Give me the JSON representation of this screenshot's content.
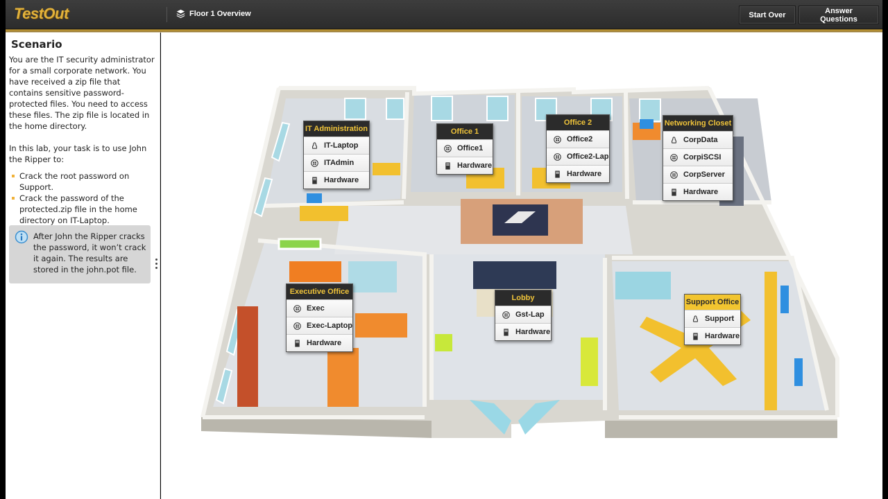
{
  "header": {
    "logo": "TestOut",
    "floor_label": "Floor 1 Overview",
    "floor_icon": "layers-icon",
    "buttons": {
      "start_over": "Start Over",
      "answer_questions": "Answer Questions"
    },
    "accent_color": "#e2b23b"
  },
  "sidebar": {
    "title": "Scenario",
    "intro": "You are the IT security administrator for a small corporate network. You have received a zip file that contains sensitive password-protected files. You need to access these files. The zip file is located in the home directory.",
    "task_lead": "In this lab, your task is to use John the Ripper to:",
    "tasks": [
      "Crack the root password on Support.",
      "Crack the password of the protected.zip file in the home directory on IT-Laptop."
    ],
    "note": "After John the Ripper cracks the password, it won’t crack it again. The results are stored in the john.pot file.",
    "note_icon": "info-icon"
  },
  "rooms": {
    "it_admin": {
      "title": "IT Administration",
      "items": [
        {
          "label": "IT-Laptop",
          "icon": "linux-icon"
        },
        {
          "label": "ITAdmin",
          "icon": "windows-icon"
        },
        {
          "label": "Hardware",
          "icon": "hardware-icon"
        }
      ]
    },
    "office1": {
      "title": "Office 1",
      "items": [
        {
          "label": "Office1",
          "icon": "windows-icon"
        },
        {
          "label": "Hardware",
          "icon": "hardware-icon"
        }
      ]
    },
    "office2": {
      "title": "Office 2",
      "items": [
        {
          "label": "Office2",
          "icon": "windows-icon"
        },
        {
          "label": "Office2-Lap",
          "icon": "windows-icon"
        },
        {
          "label": "Hardware",
          "icon": "hardware-icon"
        }
      ]
    },
    "networking_closet": {
      "title": "Networking Closet",
      "items": [
        {
          "label": "CorpData",
          "icon": "linux-icon"
        },
        {
          "label": "CorpiSCSI",
          "icon": "windows-icon"
        },
        {
          "label": "CorpServer",
          "icon": "windows-icon"
        },
        {
          "label": "Hardware",
          "icon": "hardware-icon"
        }
      ]
    },
    "executive_office": {
      "title": "Executive Office",
      "items": [
        {
          "label": "Exec",
          "icon": "windows-icon"
        },
        {
          "label": "Exec-Laptop",
          "icon": "windows-icon"
        },
        {
          "label": "Hardware",
          "icon": "hardware-icon"
        }
      ]
    },
    "lobby": {
      "title": "Lobby",
      "items": [
        {
          "label": "Gst-Lap",
          "icon": "windows-icon"
        },
        {
          "label": "Hardware",
          "icon": "hardware-icon"
        }
      ]
    },
    "support_office": {
      "title": "Support Office",
      "items": [
        {
          "label": "Support",
          "icon": "linux-icon"
        },
        {
          "label": "Hardware",
          "icon": "hardware-icon"
        }
      ]
    }
  }
}
